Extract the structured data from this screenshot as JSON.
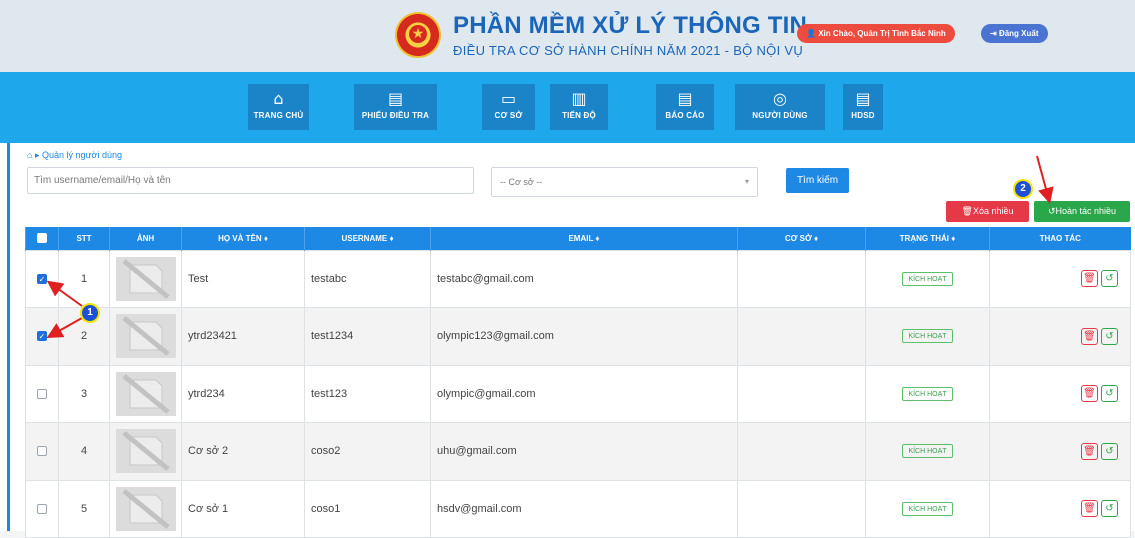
{
  "header": {
    "title": "PHẦN MỀM XỬ LÝ THÔNG TIN",
    "subtitle": "ĐIỀU TRA CƠ SỞ HÀNH CHÍNH NĂM 2021 - BỘ NỘI VỤ",
    "greeting": "Xin Chào, Quản Trị Tỉnh Bắc Ninh",
    "logout": "Đăng Xuất"
  },
  "nav": [
    {
      "label": "TRANG CHỦ",
      "icon": "home-icon",
      "glyph": "⌂"
    },
    {
      "label": "PHIẾU ĐIỀU TRA",
      "icon": "form-icon",
      "glyph": "▤"
    },
    {
      "label": "CƠ SỞ",
      "icon": "folder-icon",
      "glyph": "▭"
    },
    {
      "label": "TIẾN ĐỘ",
      "icon": "chart-icon",
      "glyph": "▥"
    },
    {
      "label": "BÁO CÁO",
      "icon": "report-icon",
      "glyph": "▤"
    },
    {
      "label": "NGƯỜI DÙNG",
      "icon": "user-icon",
      "glyph": "◎"
    },
    {
      "label": "HDSD",
      "icon": "manual-icon",
      "glyph": "▤"
    }
  ],
  "breadcrumb": {
    "home_glyph": "⌂",
    "sep": "▸",
    "label": "Quản lý người dùng"
  },
  "filters": {
    "search_placeholder": "Tìm username/email/Họ và tên",
    "facility_select": "-- Cơ sở --",
    "search_button": "Tìm kiếm"
  },
  "bulk": {
    "delete_label": "Xóa nhiều",
    "undo_label": "Hoàn tác nhiều"
  },
  "table": {
    "headers": [
      "STT",
      "ẢNH",
      "HỌ VÀ TÊN ♦",
      "USERNAME ♦",
      "EMAIL ♦",
      "CƠ SỞ ♦",
      "TRẠNG THÁI ♦",
      "THAO TÁC"
    ],
    "rows": [
      {
        "stt": "1",
        "name": "Test",
        "username": "testabc",
        "email": "testabc@gmail.com",
        "facility": "",
        "status": "KÍCH HOẠT",
        "checked": true
      },
      {
        "stt": "2",
        "name": "ytrd23421",
        "username": "test1234",
        "email": "olympic123@gmail.com",
        "facility": "",
        "status": "KÍCH HOẠT",
        "checked": true
      },
      {
        "stt": "3",
        "name": "ytrd234",
        "username": "test123",
        "email": "olympic@gmail.com",
        "facility": "",
        "status": "KÍCH HOẠT",
        "checked": false
      },
      {
        "stt": "4",
        "name": "Cơ sở 2",
        "username": "coso2",
        "email": "uhu@gmail.com",
        "facility": "",
        "status": "KÍCH HOẠT",
        "checked": false
      },
      {
        "stt": "5",
        "name": "Cơ sở 1",
        "username": "coso1",
        "email": "hsdv@gmail.com",
        "facility": "",
        "status": "KÍCH HOẠT",
        "checked": false
      }
    ]
  },
  "annotations": {
    "badge_1": "1",
    "badge_2": "2",
    "arrow_color": "#e02020"
  },
  "colors": {
    "primary": "#1e88e5",
    "danger": "#e53947",
    "success": "#2aa74a",
    "nav_bg": "#1ea7ea"
  }
}
